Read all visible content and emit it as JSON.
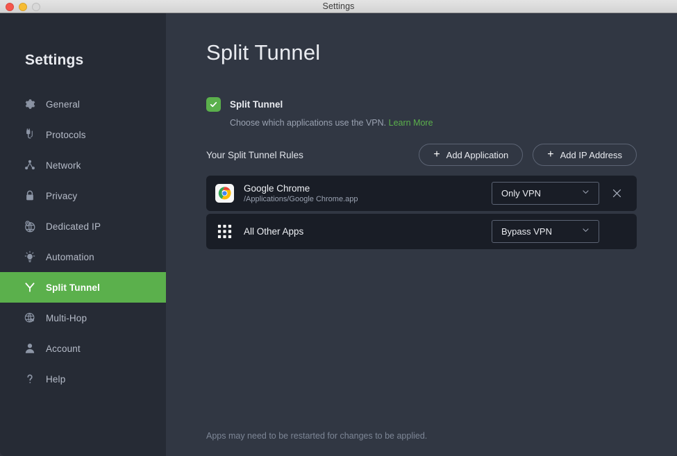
{
  "window": {
    "title": "Settings",
    "traffic_lights": [
      "close",
      "minimize",
      "zoom"
    ]
  },
  "sidebar": {
    "heading": "Settings",
    "items": [
      {
        "label": "General",
        "icon": "gear-icon",
        "active": false
      },
      {
        "label": "Protocols",
        "icon": "plug-icon",
        "active": false
      },
      {
        "label": "Network",
        "icon": "network-nodes-icon",
        "active": false
      },
      {
        "label": "Privacy",
        "icon": "lock-icon",
        "active": false
      },
      {
        "label": "Dedicated IP",
        "icon": "pin-globe-icon",
        "active": false
      },
      {
        "label": "Automation",
        "icon": "lightbulb-icon",
        "active": false
      },
      {
        "label": "Split Tunnel",
        "icon": "split-tunnel-icon",
        "active": true
      },
      {
        "label": "Multi-Hop",
        "icon": "globe-arrow-icon",
        "active": false
      },
      {
        "label": "Account",
        "icon": "person-icon",
        "active": false
      },
      {
        "label": "Help",
        "icon": "question-mark-icon",
        "active": false
      }
    ]
  },
  "main": {
    "page_title": "Split Tunnel",
    "toggle": {
      "label": "Split Tunnel",
      "checked": true,
      "description_text": "Choose which applications use the VPN.",
      "learn_more_label": "Learn More"
    },
    "rules": {
      "title": "Your Split Tunnel Rules",
      "add_application_label": "Add Application",
      "add_ip_address_label": "Add IP Address",
      "plus_glyph": "+",
      "items": [
        {
          "name": "Google Chrome",
          "path": "/Applications/Google Chrome.app",
          "icon": "chrome-icon",
          "mode": "Only VPN",
          "removable": true
        },
        {
          "name": "All Other Apps",
          "path": "",
          "icon": "apps-grid-icon",
          "mode": "Bypass VPN",
          "removable": false
        }
      ]
    },
    "footer_note": "Apps may need to be restarted for changes to be applied."
  },
  "colors": {
    "accent_green": "#5bb04c",
    "sidebar_bg": "#262b35",
    "content_bg": "#313743",
    "card_bg": "#191d26",
    "text_primary": "#e9ebf0",
    "text_muted": "#9aa2b1"
  }
}
